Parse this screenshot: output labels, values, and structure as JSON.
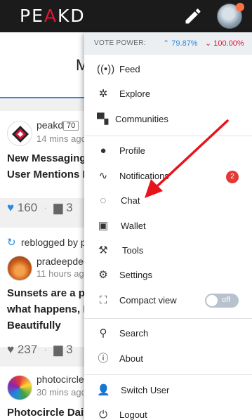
{
  "app": {
    "logo_part1": "PE",
    "logo_accent": "A",
    "logo_part2": "KD"
  },
  "feed": {
    "tab_label": "M",
    "posts": [
      {
        "author": "peakd",
        "reputation": "70",
        "time": "14 mins ago",
        "title_line1": "New Messaging S",
        "title_line2": "User Mentions He",
        "votes": "160",
        "comments": "3"
      },
      {
        "reblog_text": "reblogged by pl",
        "author": "pradeepdee",
        "time": "11 hours ago",
        "title_line1": "Sunsets are a pro",
        "title_line2": "what happens, Ev",
        "title_line3": "Beautifully",
        "votes": "237",
        "comments": "3"
      },
      {
        "author": "photocircle",
        "time": "30 mins ago",
        "title_line1": "Photocircle Daily"
      }
    ]
  },
  "menu": {
    "vote_power_label": "VOTE POWER:",
    "vote_up": "79.87%",
    "vote_down": "100.00%",
    "items": [
      {
        "label": "Feed",
        "icon": "broadcast-icon"
      },
      {
        "label": "Explore",
        "icon": "compass-icon"
      },
      {
        "label": "Communities",
        "icon": "chat-bubbles-icon"
      },
      {
        "label": "Profile",
        "icon": "user-icon"
      },
      {
        "label": "Notifications",
        "icon": "heartbeat-icon",
        "badge": "2"
      },
      {
        "label": "Chat",
        "icon": "chat-icon"
      },
      {
        "label": "Wallet",
        "icon": "wallet-icon"
      },
      {
        "label": "Tools",
        "icon": "tools-icon"
      },
      {
        "label": "Settings",
        "icon": "gear-icon"
      },
      {
        "label": "Compact view",
        "icon": "compact-view-icon",
        "toggle": "off"
      },
      {
        "label": "Search",
        "icon": "search-icon"
      },
      {
        "label": "About",
        "icon": "info-icon"
      },
      {
        "label": "Switch User",
        "icon": "switch-user-icon"
      },
      {
        "label": "Logout",
        "icon": "power-icon"
      }
    ]
  },
  "colors": {
    "brand": "#e31337",
    "accent": "#2a8bde",
    "topbar": "#1b1b1b",
    "arrow": "#e8141b"
  }
}
